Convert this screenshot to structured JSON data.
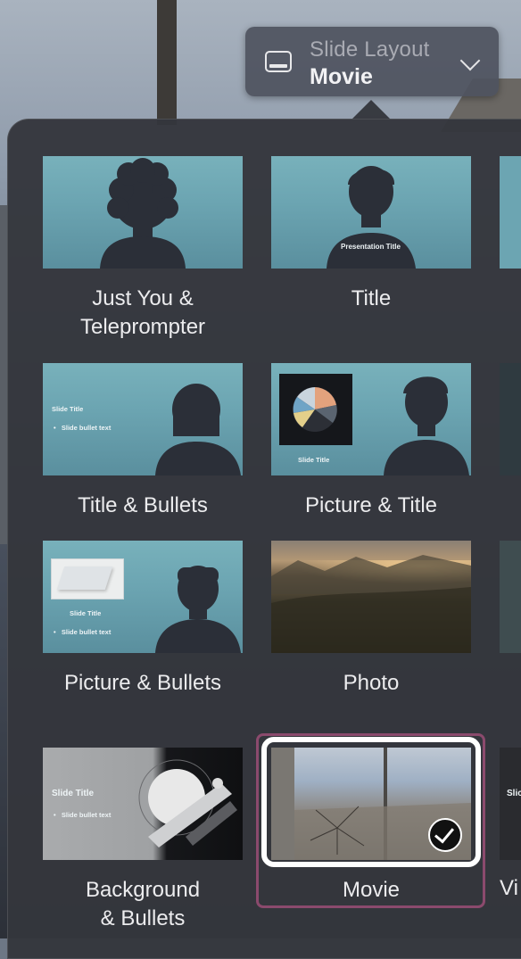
{
  "popup": {
    "caption": "Slide Layout",
    "value": "Movie",
    "icon": "slide-layout-icon",
    "chevron": "chevron-down-icon"
  },
  "layouts": [
    {
      "label_line1": "Just You &",
      "label_line2": "Teleprompter",
      "thumb_text": []
    },
    {
      "label_line1": "Title",
      "label_line2": "",
      "thumb_text": [
        "Presentation Title"
      ]
    },
    {
      "label_line1": "Title & Bullets",
      "label_line2": "",
      "thumb_text": [
        "Slide Title",
        "Slide bullet text"
      ]
    },
    {
      "label_line1": "Picture & Title",
      "label_line2": "",
      "thumb_text": [
        "Slide Title"
      ]
    },
    {
      "label_line1": "Picture & Bullets",
      "label_line2": "",
      "thumb_text": [
        "Slide Title",
        "Slide bullet text"
      ]
    },
    {
      "label_line1": "Photo",
      "label_line2": "",
      "thumb_text": []
    },
    {
      "label_line1": "Background",
      "label_line2": "& Bullets",
      "thumb_text": [
        "Slide Title",
        "Slide bullet text"
      ]
    },
    {
      "label_line1": "Movie",
      "label_line2": "",
      "thumb_text": [],
      "selected": true
    }
  ],
  "partial_labels": {
    "row4": "Vi",
    "row4_thumb": "Slic"
  },
  "colors": {
    "selection_border": "#8b4a6d",
    "thumb_teal": "#6ca5b2",
    "panel_bg": "#34363c"
  }
}
